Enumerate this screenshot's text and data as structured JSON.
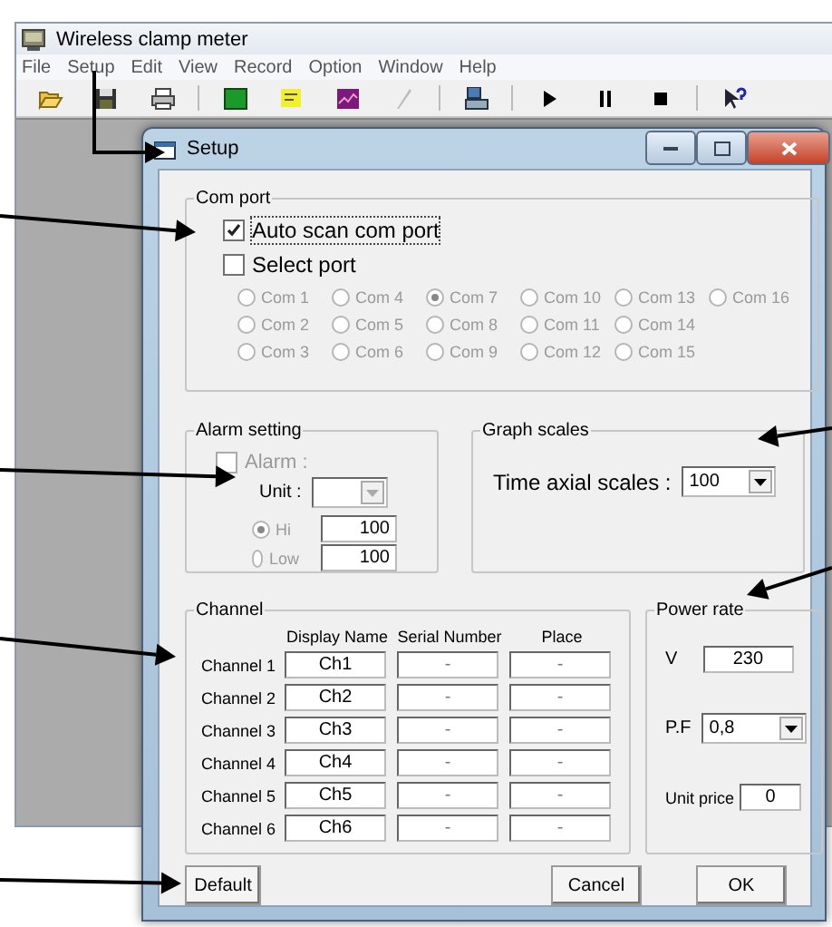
{
  "app": {
    "title": "Wireless clamp meter",
    "menu": [
      "File",
      "Setup",
      "Edit",
      "View",
      "Record",
      "Option",
      "Window",
      "Help"
    ]
  },
  "dialog": {
    "title": "Setup",
    "com_port": {
      "legend": "Com port",
      "auto_scan": {
        "label": "Auto scan  com port",
        "checked": true
      },
      "select_port": {
        "label": "Select port",
        "checked": false
      },
      "ports_disabled": true,
      "ports": [
        {
          "label": "Com 1",
          "selected": false
        },
        {
          "label": "Com 2",
          "selected": false
        },
        {
          "label": "Com 3",
          "selected": false
        },
        {
          "label": "Com 4",
          "selected": false
        },
        {
          "label": "Com 5",
          "selected": false
        },
        {
          "label": "Com 6",
          "selected": false
        },
        {
          "label": "Com 7",
          "selected": true
        },
        {
          "label": "Com 8",
          "selected": false
        },
        {
          "label": "Com 9",
          "selected": false
        },
        {
          "label": "Com 10",
          "selected": false
        },
        {
          "label": "Com 11",
          "selected": false
        },
        {
          "label": "Com 12",
          "selected": false
        },
        {
          "label": "Com 13",
          "selected": false
        },
        {
          "label": "Com 14",
          "selected": false
        },
        {
          "label": "Com 15",
          "selected": false
        },
        {
          "label": "Com 16",
          "selected": false
        }
      ]
    },
    "alarm": {
      "legend": "Alarm setting",
      "disabled": true,
      "alarm": {
        "label": "Alarm :",
        "checked": false
      },
      "unit_label": "Unit :",
      "levels": [
        {
          "label": "Hi",
          "selected": true,
          "value": "100"
        },
        {
          "label": "Low",
          "selected": false,
          "value": "100"
        }
      ]
    },
    "graph": {
      "legend": "Graph scales",
      "label": "Time axial scales :",
      "value": "100"
    },
    "channel": {
      "legend": "Channel",
      "columns": [
        "Display  Name",
        "Serial Number",
        "Place"
      ],
      "rows": [
        {
          "label": "Channel 1",
          "display_name": "Ch1",
          "serial": "-",
          "place": "-"
        },
        {
          "label": "Channel 2",
          "display_name": "Ch2",
          "serial": "-",
          "place": "-"
        },
        {
          "label": "Channel 3",
          "display_name": "Ch3",
          "serial": "-",
          "place": "-"
        },
        {
          "label": "Channel 4",
          "display_name": "Ch4",
          "serial": "-",
          "place": "-"
        },
        {
          "label": "Channel 5",
          "display_name": "Ch5",
          "serial": "-",
          "place": "-"
        },
        {
          "label": "Channel 6",
          "display_name": "Ch6",
          "serial": "-",
          "place": "-"
        }
      ]
    },
    "power": {
      "legend": "Power rate",
      "v_label": "V",
      "v_value": "230",
      "pf_label": "P.F",
      "pf_value": "0,8",
      "price_label": "Unit price",
      "price_value": "0"
    },
    "buttons": [
      "Default",
      "Cancel",
      "OK"
    ]
  }
}
